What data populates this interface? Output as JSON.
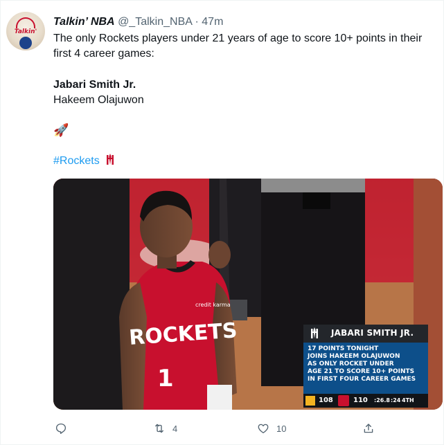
{
  "tweet": {
    "display_name": "Talkin’ NBA",
    "handle": "@_Talkin_NBA",
    "separator": "·",
    "time": "47m",
    "avatar_text": "Talkin'",
    "text_line": "The only Rockets players under 21 years of age to score 10+ points in their first 4 career games:",
    "player1": "Jabari Smith Jr.",
    "player2": "Hakeem Olajuwon",
    "emoji": "🚀",
    "hashtag": "#Rockets"
  },
  "media": {
    "jersey_team": "ROCKETS",
    "jersey_number": "1",
    "jersey_sponsor": "credit karma",
    "graphic": {
      "title": "JABARI SMITH JR.",
      "highlight": "17 POINTS TONIGHT",
      "lines": [
        "JOINS HAKEEM OLAJUWON",
        "AS ONLY ROCKET UNDER",
        "AGE 21 TO SCORE 10+ POINTS",
        "IN FIRST FOUR CAREER GAMES"
      ],
      "score_away": "108",
      "score_home": "110",
      "clock": ":26.8",
      "shot_clock": ":24",
      "quarter": "4TH"
    }
  },
  "actions": {
    "reply_count": "",
    "retweet_count": "4",
    "like_count": "10",
    "share_count": ""
  },
  "colors": {
    "link": "#1d9bf0",
    "rockets_red": "#c8102e",
    "muted": "#536471"
  }
}
